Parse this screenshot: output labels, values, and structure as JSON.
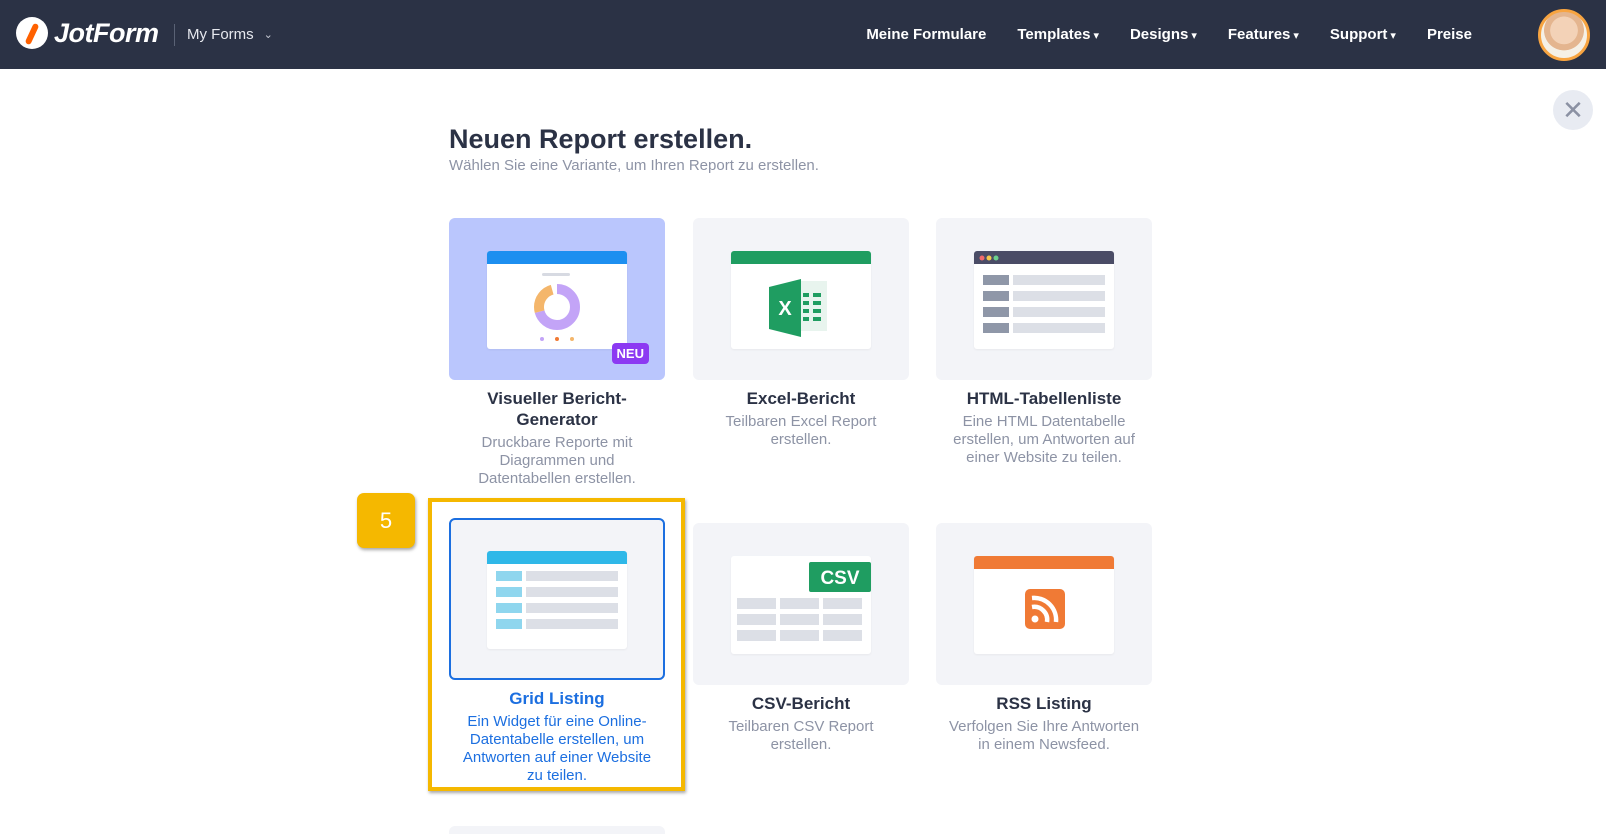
{
  "header": {
    "logo_text": "JotForm",
    "my_forms_label": "My Forms",
    "nav": [
      {
        "label": "Meine Formulare",
        "dropdown": false
      },
      {
        "label": "Templates",
        "dropdown": true
      },
      {
        "label": "Designs",
        "dropdown": true
      },
      {
        "label": "Features",
        "dropdown": true
      },
      {
        "label": "Support",
        "dropdown": true
      },
      {
        "label": "Preise",
        "dropdown": false
      }
    ],
    "caret": "▾"
  },
  "main": {
    "title": "Neuen Report erstellen.",
    "subtitle": "Wählen Sie eine Variante, um Ihren Report zu erstellen.",
    "close_symbol": "✕"
  },
  "cards": [
    {
      "title": "Visueller Bericht-Generator",
      "desc": "Druckbare Reporte mit Diagrammen und Datentabellen erstellen.",
      "badge": "NEU",
      "icon": "donut-chart-icon"
    },
    {
      "title": "Excel-Bericht",
      "desc": "Teilbaren Excel Report erstellen.",
      "icon": "excel-icon"
    },
    {
      "title": "HTML-Tabellenliste",
      "desc": "Eine HTML Datentabelle erstellen, um Antworten auf einer Website zu teilen.",
      "icon": "html-table-icon"
    },
    {
      "title": "Grid Listing",
      "desc": "Ein Widget für eine Online-Datentabelle erstellen, um Antworten auf einer Website zu teilen.",
      "icon": "grid-table-icon",
      "selected": true
    },
    {
      "title": "CSV-Bericht",
      "desc": "Teilbaren CSV Report erstellen.",
      "badge": "CSV",
      "icon": "csv-icon"
    },
    {
      "title": "RSS Listing",
      "desc": "Verfolgen Sie Ihre Antworten in einem Newsfeed.",
      "icon": "rss-icon"
    }
  ],
  "annotation": {
    "step": "5"
  },
  "colors": {
    "header_bg": "#2b3245",
    "accent_blue": "#1c6fe0",
    "highlight": "#f5b800",
    "neu_badge": "#8c3af2",
    "excel_green": "#1f9d61",
    "rss_orange": "#f07a35"
  }
}
